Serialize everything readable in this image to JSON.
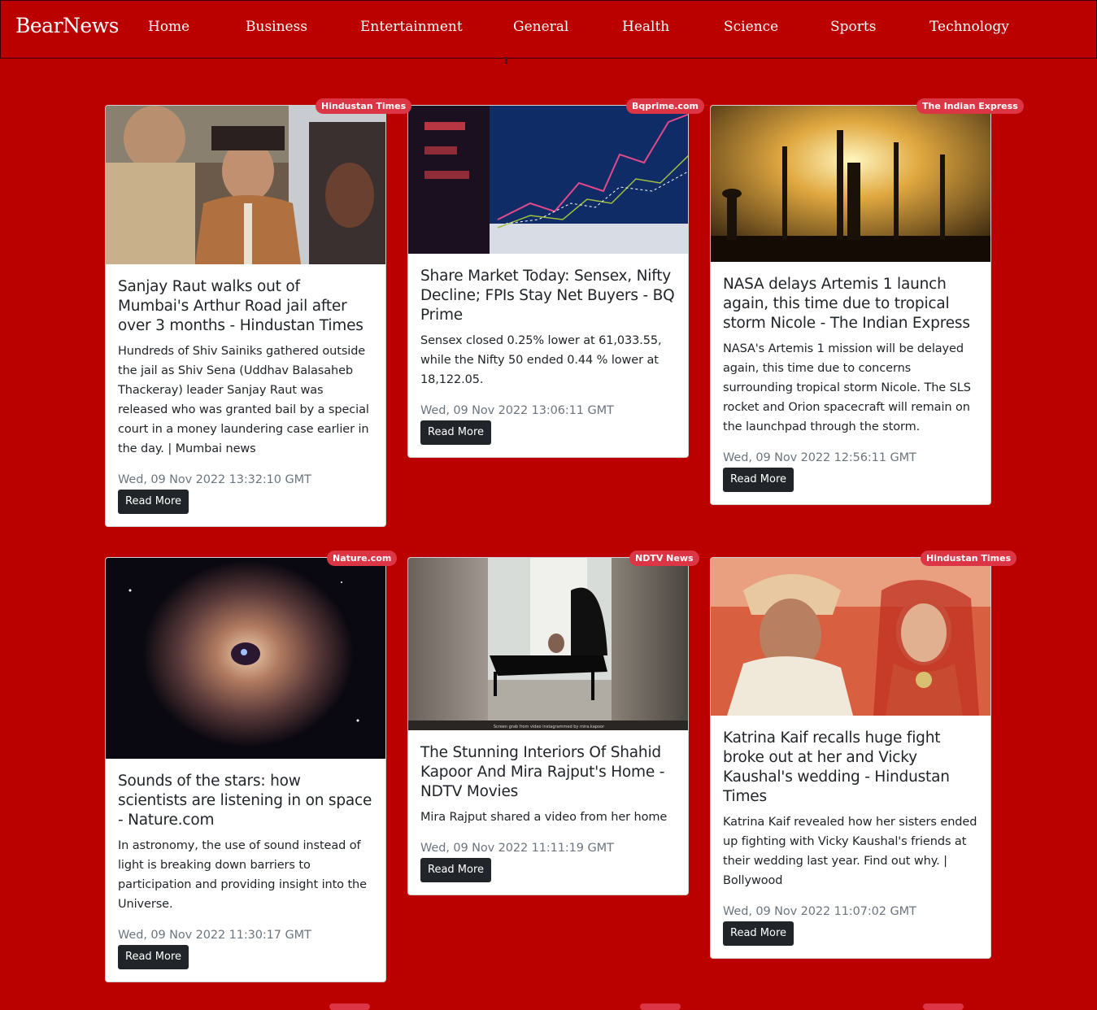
{
  "brand": "BearNews",
  "nav": [
    "Home",
    "Business",
    "Entertainment",
    "General",
    "Health",
    "Science",
    "Sports",
    "Technology"
  ],
  "articles": [
    {
      "source": "Hindustan Times",
      "title": "Sanjay Raut walks out of Mumbai's Arthur Road jail after over 3 months - Hindustan Times",
      "description": "Hundreds of Shiv Sainiks gathered outside the jail as Shiv Sena (Uddhav Balasaheb Thackeray) leader Sanjay Raut was released who was granted bail by a special court in a money laundering case earlier in the day. | Mumbai news",
      "date": "Wed, 09 Nov 2022 13:32:10 GMT",
      "button": "Read More"
    },
    {
      "source": "Bqprime.com",
      "title": "Share Market Today: Sensex, Nifty Decline; FPIs Stay Net Buyers - BQ Prime",
      "description": "Sensex closed 0.25% lower at 61,033.55, while the Nifty 50 ended 0.44 % lower at 18,122.05.",
      "date": "Wed, 09 Nov 2022 13:06:11 GMT",
      "button": "Read More"
    },
    {
      "source": "The Indian Express",
      "title": "NASA delays Artemis 1 launch again, this time due to tropical storm Nicole - The Indian Express",
      "description": "NASA's Artemis 1 mission will be delayed again, this time due to concerns surrounding tropical storm Nicole. The SLS rocket and Orion spacecraft will remain on the launchpad through the storm.",
      "date": "Wed, 09 Nov 2022 12:56:11 GMT",
      "button": "Read More"
    },
    {
      "source": "Nature.com",
      "title": "Sounds of the stars: how scientists are listening in on space - Nature.com",
      "description": "In astronomy, the use of sound instead of light is breaking down barriers to participation and providing insight into the Universe.",
      "date": "Wed, 09 Nov 2022 11:30:17 GMT",
      "button": "Read More"
    },
    {
      "source": "NDTV News",
      "title": "The Stunning Interiors Of Shahid Kapoor And Mira Rajput's Home - NDTV Movies",
      "description": "Mira Rajput shared a video from her home",
      "date": "Wed, 09 Nov 2022 11:11:19 GMT",
      "button": "Read More",
      "image_caption": "Screen grab from video instagrammed by mira.kapoor"
    },
    {
      "source": "Hindustan Times",
      "title": "Katrina Kaif recalls huge fight broke out at her and Vicky Kaushal's wedding - Hindustan Times",
      "description": "Katrina Kaif revealed how her sisters ended up fighting with Vicky Kaushal's friends at their wedding last year. Find out why. | Bollywood",
      "date": "Wed, 09 Nov 2022 11:07:02 GMT",
      "button": "Read More"
    }
  ]
}
